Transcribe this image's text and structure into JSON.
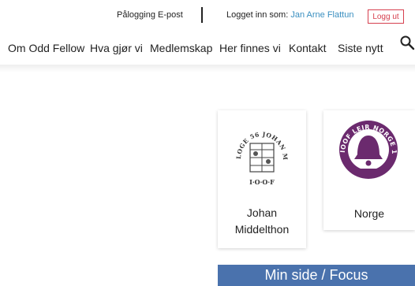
{
  "topbar": {
    "login_email": "Pålogging E-post",
    "logged_in_prefix": "Logget inn som: ",
    "user_name": "Jan Arne Flattun",
    "logout_label": "Logg ut"
  },
  "nav": {
    "items": [
      {
        "label": "Om Odd Fellow"
      },
      {
        "label": "Hva gjør vi"
      },
      {
        "label": "Medlemskap"
      },
      {
        "label": "Her finnes vi"
      },
      {
        "label": "Kontakt"
      },
      {
        "label": "Siste nytt"
      }
    ]
  },
  "cards": [
    {
      "label_line1": "Johan",
      "label_line2": "Middelthon",
      "logo_text": "LOGE 56 JOHAN MIDDELTHON",
      "logo_bottom": "I·O·O·F"
    },
    {
      "label": "Norge",
      "logo_text": "IOOF LEIR NORGE 1919"
    }
  ],
  "minside": {
    "label": "Min side / Focus"
  },
  "colors": {
    "accent_blue": "#4a72ad",
    "link_blue": "#3a8fc0",
    "logout_red": "#d6404f",
    "norge_purple": "#6b2a6e"
  }
}
